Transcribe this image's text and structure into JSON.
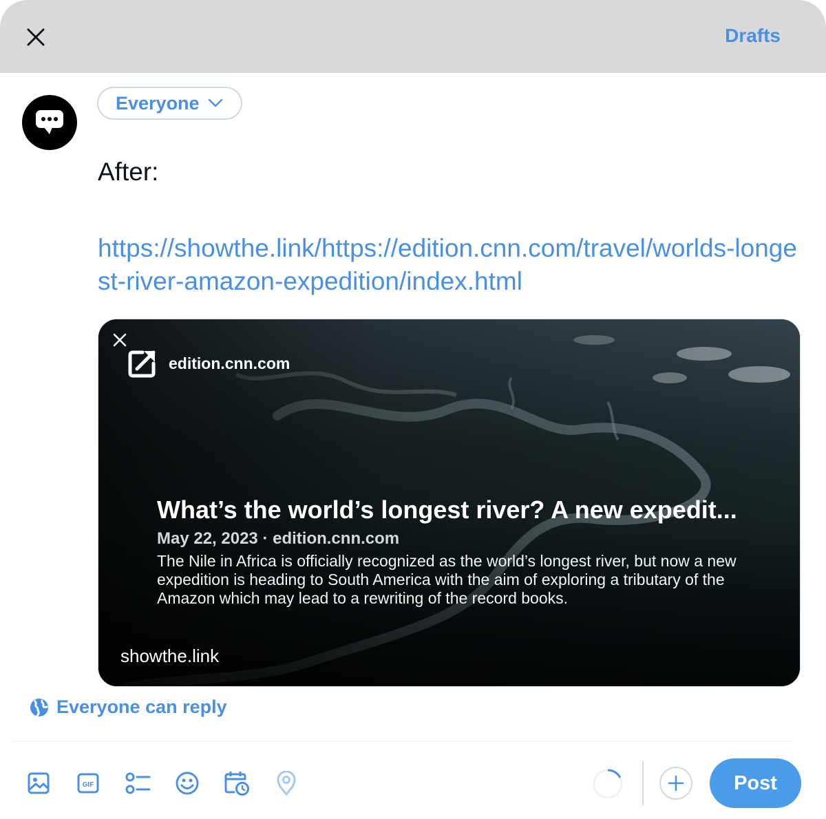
{
  "header": {
    "drafts_label": "Drafts"
  },
  "composer": {
    "audience_label": "Everyone",
    "text": "After:",
    "link": "https://showthe.link/https://edition.cnn.com/travel/worlds-longest-river-amazon-expedition/index.html"
  },
  "card": {
    "domain": "edition.cnn.com",
    "title": "What’s the world’s longest river? A new expedit...",
    "meta": "May 22, 2023 · edition.cnn.com",
    "description": "The Nile in Africa is officially recognized as the world’s longest river, but now a new expedition is heading to South America with the aim of exploring a tributary of the Amazon which may lead to a rewriting of the record books.",
    "footer": "showthe.link"
  },
  "reply_setting": "Everyone can reply",
  "toolbar": {
    "post_label": "Post",
    "icons": [
      "image-icon",
      "gif-icon",
      "poll-icon",
      "emoji-icon",
      "schedule-icon",
      "location-icon"
    ]
  },
  "colors": {
    "accent": "#4a90e2",
    "post_button": "#4a9be8",
    "topbar": "#d9d9d9"
  }
}
